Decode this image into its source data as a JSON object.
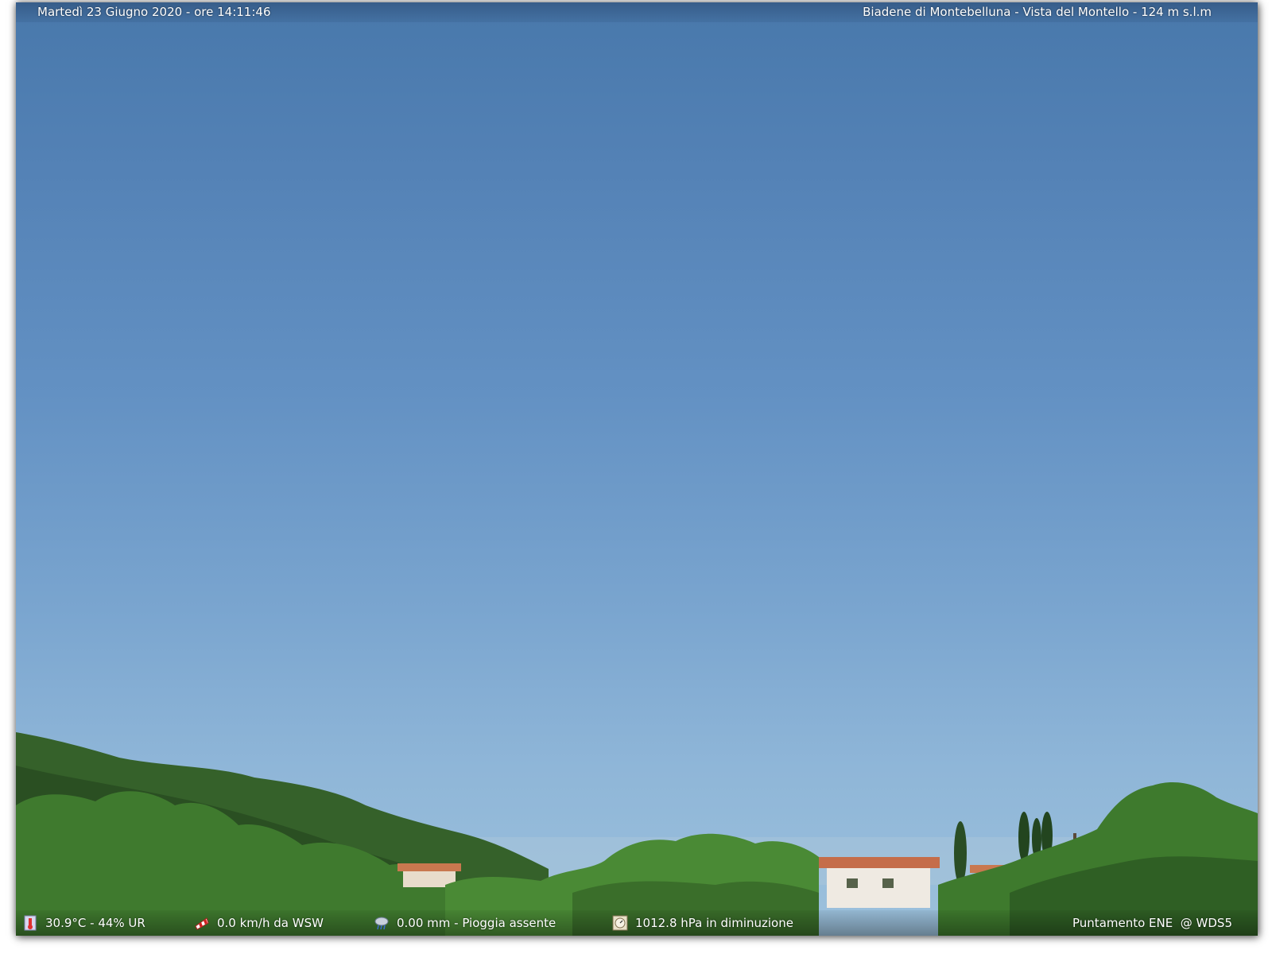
{
  "overlay": {
    "datetime": "Martedì 23 Giugno 2020 - ore 14:11:46",
    "location": "Biadene di Montebelluna - Vista del Montello - 124 m s.l.m"
  },
  "weather": {
    "temperature_humidity": "30.9°C - 44% UR",
    "wind": "0.0 km/h da WSW",
    "rain": "0.00 mm - Pioggia assente",
    "pressure": "1012.8 hPa in diminuzione",
    "pointing": "Puntamento ENE  @ WDS5"
  },
  "icons": {
    "temperature": "thermometer-icon",
    "wind": "windsock-icon",
    "rain": "rain-cloud-icon",
    "pressure": "barometer-icon"
  },
  "colors": {
    "sky_top": "#4878ab",
    "sky_bottom": "#9cc1dc",
    "vegetation": "#2f5a22",
    "overlay_text": "#ffffff"
  }
}
